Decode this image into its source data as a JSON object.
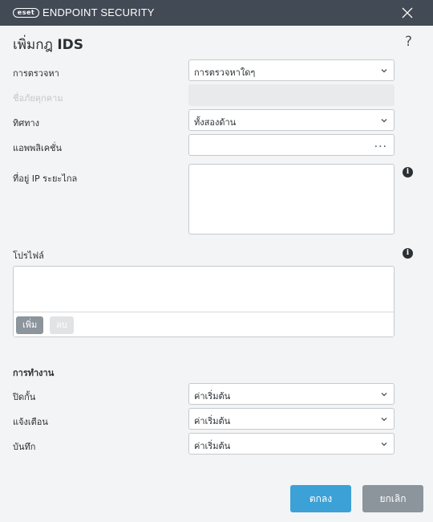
{
  "window": {
    "logo_text": "eset",
    "app_title": "ENDPOINT SECURITY"
  },
  "dialog": {
    "title_prefix": "เพิ่มกฎ",
    "title_bold": "IDS",
    "help": "?"
  },
  "form": {
    "detection_label": "การตรวจหา",
    "detection_value": "การตรวจหาใดๆ",
    "threat_name_label": "ชื่อภัยคุกคาม",
    "direction_label": "ทิศทาง",
    "direction_value": "ทั้งสองด้าน",
    "application_label": "แอพพลิเคชั่น",
    "browse": "...",
    "remote_ip_label": "ที่อยู่ IP ระยะไกล",
    "info": "i"
  },
  "profile": {
    "label": "โปรไฟล์",
    "add": "เพิ่ม",
    "delete": "ลบ"
  },
  "actions": {
    "section_title": "การทำงาน",
    "block_label": "ปิดกั้น",
    "block_value": "ค่าเริ่มต้น",
    "notify_label": "แจ้งเตือน",
    "notify_value": "ค่าเริ่มต้น",
    "log_label": "บันทึก",
    "log_value": "ค่าเริ่มต้น"
  },
  "footer": {
    "ok": "ตกลง",
    "cancel": "ยกเลิก"
  }
}
